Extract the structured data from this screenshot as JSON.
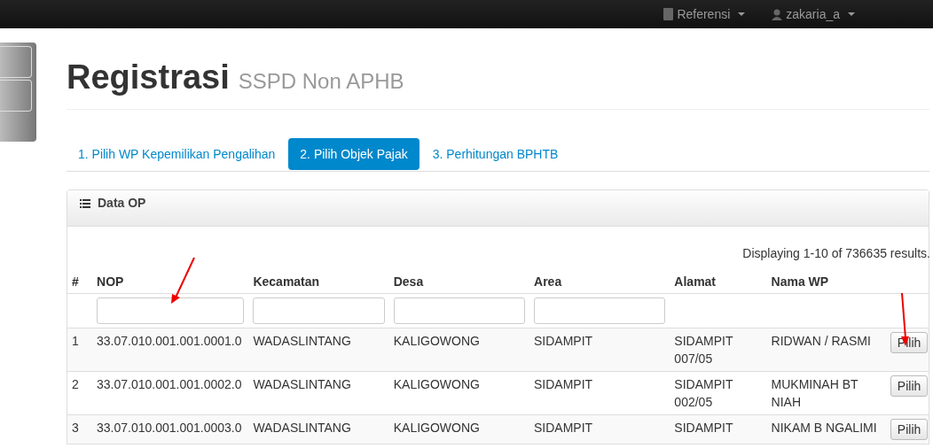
{
  "navbar": {
    "items": [
      {
        "label": "Referensi"
      },
      {
        "label": "zakaria_a"
      }
    ]
  },
  "page": {
    "title": "Registrasi",
    "subtitle": "SSPD Non APHB"
  },
  "tabs": [
    {
      "label": "1. Pilih WP Kepemilikan Pengalihan",
      "selected": false
    },
    {
      "label": "2. Pilih Objek Pajak",
      "selected": true
    },
    {
      "label": "3. Perhitungan BPHTB",
      "selected": false
    }
  ],
  "panel": {
    "title": "Data OP",
    "summary": "Displaying 1-10 of 736635 results."
  },
  "table": {
    "columns": [
      {
        "label": "#",
        "filter": false
      },
      {
        "label": "NOP",
        "filter": true
      },
      {
        "label": "Kecamatan",
        "filter": true
      },
      {
        "label": "Desa",
        "filter": true
      },
      {
        "label": "Area",
        "filter": true
      },
      {
        "label": "Alamat",
        "filter": false
      },
      {
        "label": "Nama WP",
        "filter": false
      }
    ],
    "rows": [
      {
        "cells": [
          "1",
          "33.07.010.001.001.0001.0",
          "WADASLINTANG",
          "KALIGOWONG",
          "SIDAMPIT",
          "SIDAMPIT 007/05",
          "RIDWAN / RASMI"
        ],
        "action": "Pilih"
      },
      {
        "cells": [
          "2",
          "33.07.010.001.001.0002.0",
          "WADASLINTANG",
          "KALIGOWONG",
          "SIDAMPIT",
          "SIDAMPIT 002/05",
          "MUKMINAH BT NIAH"
        ],
        "action": "Pilih"
      },
      {
        "cells": [
          "3",
          "33.07.010.001.001.0003.0",
          "WADASLINTANG",
          "KALIGOWONG",
          "SIDAMPIT",
          "SIDAMPIT",
          "NIKAM B NGALIMI"
        ],
        "action": "Pilih"
      }
    ]
  }
}
